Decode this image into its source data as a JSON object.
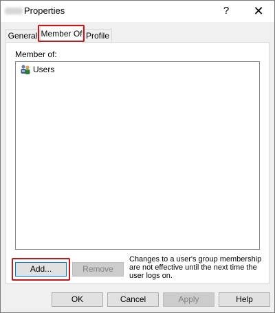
{
  "window": {
    "title": "Properties",
    "help_glyph": "?",
    "close_glyph": "✕"
  },
  "tabs": [
    {
      "label": "General"
    },
    {
      "label": "Member Of",
      "selected": true
    },
    {
      "label": "Profile"
    }
  ],
  "member_of": {
    "label": "Member of:",
    "items": [
      {
        "name": "Users",
        "icon": "group-icon"
      }
    ]
  },
  "buttons": {
    "add": "Add...",
    "remove": "Remove",
    "ok": "OK",
    "cancel": "Cancel",
    "apply": "Apply",
    "help": "Help"
  },
  "note": "Changes to a user's group membership are not effective until the next time the user logs on.",
  "colors": {
    "highlight": "#c0181c",
    "focus": "#0078d7"
  }
}
